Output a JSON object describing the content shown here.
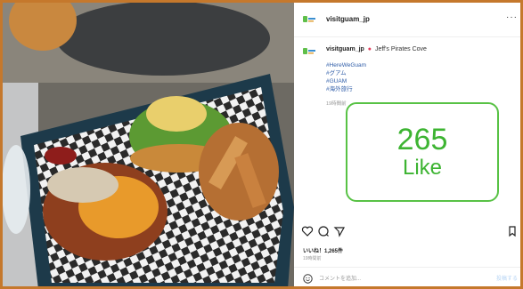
{
  "post": {
    "username": "visitguam_jp",
    "more_icon": "more-horizontal-icon",
    "caption_user": "visitguam_jp",
    "location": "Jeff's Pirates Cove",
    "hashtags": [
      "#HereWeGuam",
      "#グアム",
      "#GUAM",
      "#海外旅行"
    ],
    "caption_time": "19時間前",
    "likes": "いいね！1,265件",
    "likes_time": "19時間前",
    "comment_placeholder": "コメントを追加...",
    "post_button": "投稿する"
  },
  "overlay": {
    "count": "265",
    "label": "Like",
    "color": "#3db432"
  },
  "icons": [
    "heart-icon",
    "comment-icon",
    "share-icon",
    "bookmark-icon",
    "smiley-icon",
    "location-pin-icon"
  ]
}
